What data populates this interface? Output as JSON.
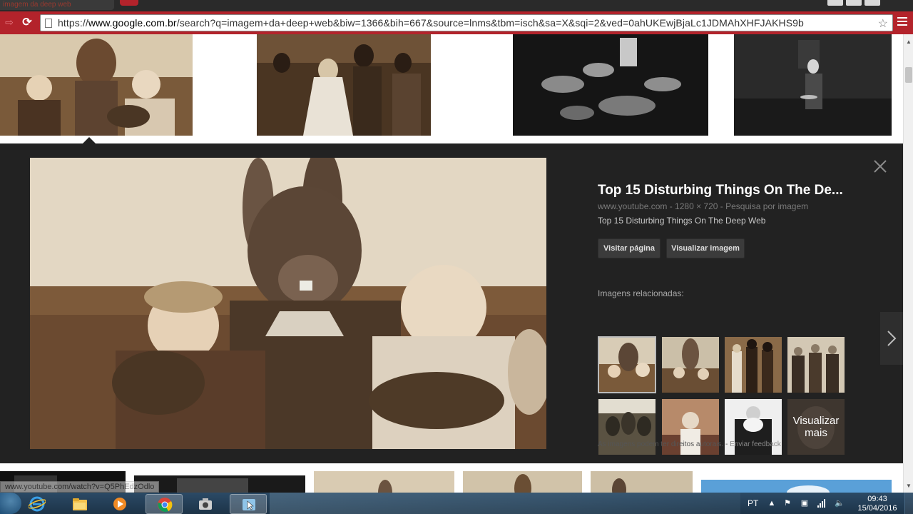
{
  "browser": {
    "tab_title": "imagem da deep web",
    "url_scheme": "https://",
    "url_host": "www.google.com.br",
    "url_path": "/search?q=imagem+da+deep+web&biw=1366&bih=667&source=lnms&tbm=isch&sa=X&sqi=2&ved=0ahUKEwjBjaLc1JDMAhXHFJAKHS9b"
  },
  "panel": {
    "title": "Top 15 Disturbing Things On The De...",
    "meta": "www.youtube.com - 1280 × 720 - Pesquisa por imagem",
    "description": "Top 15 Disturbing Things On The Deep Web",
    "visit_button": "Visitar página",
    "view_button": "Visualizar imagem",
    "related_label": "Imagens relacionadas:",
    "more_label": "Visualizar mais",
    "footer_note": "As imagens podem ter direitos autorais.",
    "footer_separator": " - ",
    "feedback_link": "Enviar feedback"
  },
  "status_url": "www.youtube.com/watch?v=Q5PhEdzOdlo",
  "taskbar": {
    "language": "PT",
    "time": "09:43",
    "date": "15/04/2016"
  },
  "colors": {
    "toolbar": "#b3232b",
    "panel_bg": "#222222",
    "button_bg": "#3b3b3b",
    "sepia_light": "#e3d7c3",
    "sepia_dark": "#5a3f2a"
  }
}
